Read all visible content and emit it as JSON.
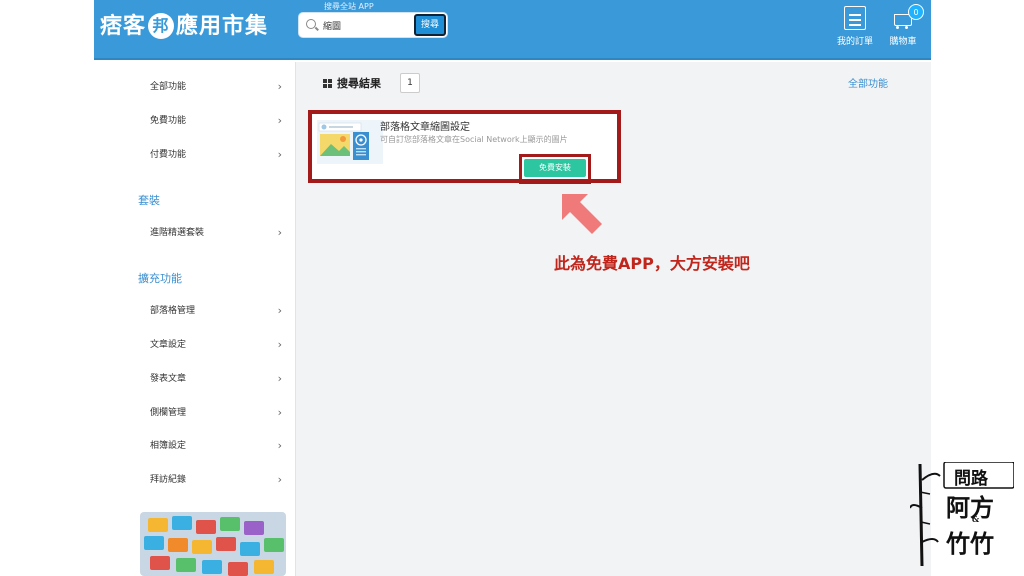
{
  "header": {
    "logo_text_a": "痞客",
    "logo_mark": "邦",
    "logo_text_b": "應用市集",
    "search_caption": "搜尋全站 APP",
    "search_value": "縮圖",
    "search_button": "搜尋",
    "orders_label": "我的訂單",
    "cart_label": "購物車",
    "cart_count": "0"
  },
  "sidebar": {
    "items_top": [
      {
        "label": "全部功能"
      },
      {
        "label": "免費功能"
      },
      {
        "label": "付費功能"
      }
    ],
    "section_bundle": "套裝",
    "items_bundle": [
      {
        "label": "進階精選套裝"
      }
    ],
    "section_ext": "擴充功能",
    "items_ext": [
      {
        "label": "部落格管理"
      },
      {
        "label": "文章設定"
      },
      {
        "label": "發表文章"
      },
      {
        "label": "側欄管理"
      },
      {
        "label": "相簿設定"
      },
      {
        "label": "拜訪紀錄"
      }
    ],
    "chevron": "›"
  },
  "main": {
    "results_title": "搜尋結果",
    "page_number": "1",
    "all_functions_link": "全部功能",
    "app": {
      "name": "部落格文章縮圖設定",
      "description": "可自訂您部落格文章在Social Network上顯示的圖片",
      "install_label": "免費安裝"
    },
    "annotation": "此為免費APP，大方安裝吧"
  },
  "watermark": {
    "line1": "問路",
    "line2": "阿方",
    "amp": "&",
    "line3": "竹竹"
  },
  "colors": {
    "header_blue": "#3a9ad9",
    "highlight_red": "#a31a1a",
    "install_green": "#2cc6a0",
    "annotation_red": "#c0261c",
    "arrow_pink": "#f07a7a"
  }
}
